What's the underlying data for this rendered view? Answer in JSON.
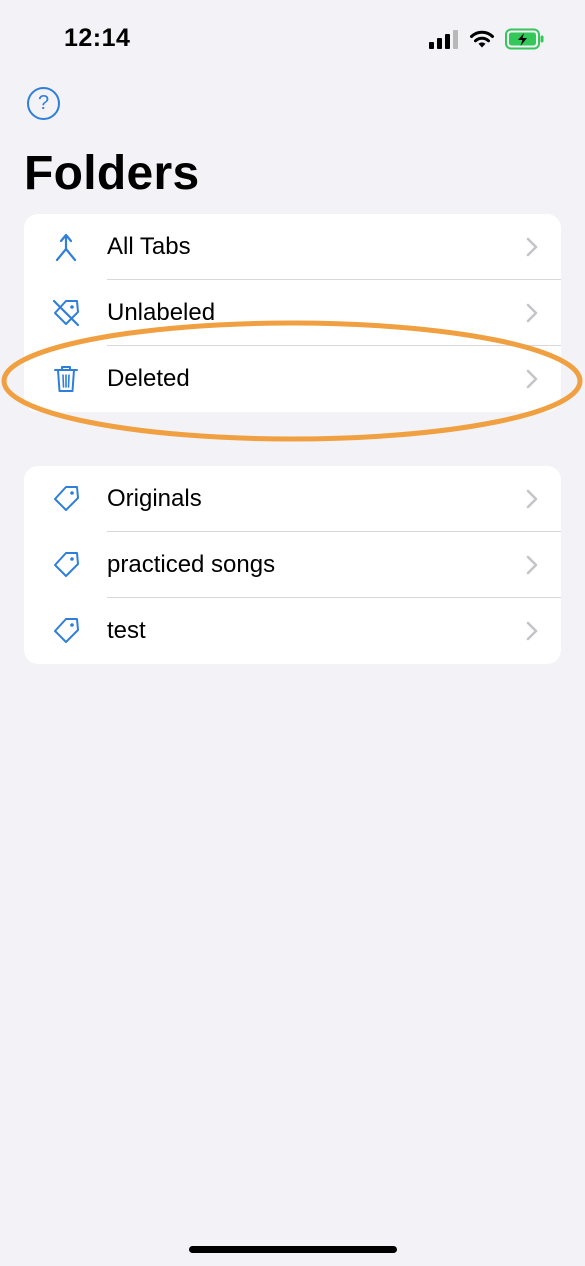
{
  "status_bar": {
    "time": "12:14",
    "signal_icon": "cellular-signal-icon",
    "wifi_icon": "wifi-icon",
    "battery_icon": "battery-charging-icon",
    "battery_color": "#34c759"
  },
  "header": {
    "help_icon_glyph": "?",
    "title": "Folders"
  },
  "groups": [
    {
      "items": [
        {
          "label": "All Tabs",
          "icon": "merge-arrow-icon"
        },
        {
          "label": "Unlabeled",
          "icon": "tag-slash-icon"
        },
        {
          "label": "Deleted",
          "icon": "trash-icon"
        }
      ]
    },
    {
      "items": [
        {
          "label": "Originals",
          "icon": "tag-icon"
        },
        {
          "label": "practiced songs",
          "icon": "tag-icon"
        },
        {
          "label": "test",
          "icon": "tag-icon"
        }
      ]
    }
  ],
  "colors": {
    "accent": "#2f7fd9",
    "background": "#f2f2f7",
    "annotation": "#f0a040"
  }
}
